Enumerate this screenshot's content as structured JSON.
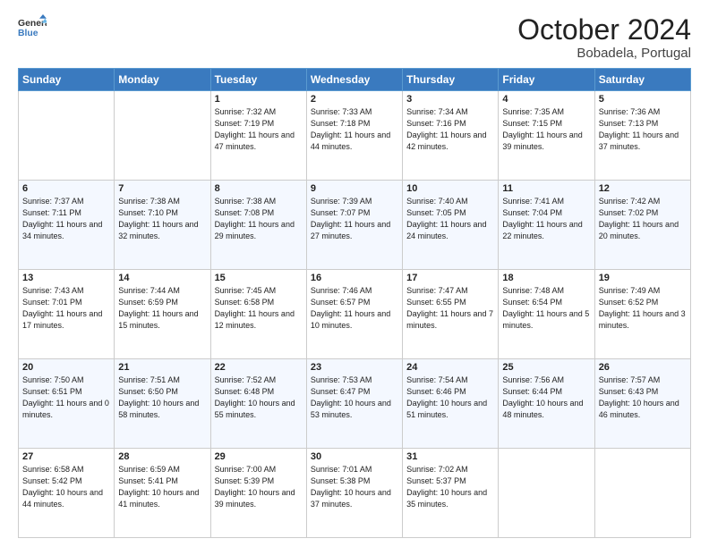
{
  "header": {
    "logo_line1": "General",
    "logo_line2": "Blue",
    "title": "October 2024",
    "subtitle": "Bobadela, Portugal"
  },
  "weekdays": [
    "Sunday",
    "Monday",
    "Tuesday",
    "Wednesday",
    "Thursday",
    "Friday",
    "Saturday"
  ],
  "weeks": [
    [
      {
        "day": "",
        "info": ""
      },
      {
        "day": "",
        "info": ""
      },
      {
        "day": "1",
        "info": "Sunrise: 7:32 AM\nSunset: 7:19 PM\nDaylight: 11 hours and 47 minutes."
      },
      {
        "day": "2",
        "info": "Sunrise: 7:33 AM\nSunset: 7:18 PM\nDaylight: 11 hours and 44 minutes."
      },
      {
        "day": "3",
        "info": "Sunrise: 7:34 AM\nSunset: 7:16 PM\nDaylight: 11 hours and 42 minutes."
      },
      {
        "day": "4",
        "info": "Sunrise: 7:35 AM\nSunset: 7:15 PM\nDaylight: 11 hours and 39 minutes."
      },
      {
        "day": "5",
        "info": "Sunrise: 7:36 AM\nSunset: 7:13 PM\nDaylight: 11 hours and 37 minutes."
      }
    ],
    [
      {
        "day": "6",
        "info": "Sunrise: 7:37 AM\nSunset: 7:11 PM\nDaylight: 11 hours and 34 minutes."
      },
      {
        "day": "7",
        "info": "Sunrise: 7:38 AM\nSunset: 7:10 PM\nDaylight: 11 hours and 32 minutes."
      },
      {
        "day": "8",
        "info": "Sunrise: 7:38 AM\nSunset: 7:08 PM\nDaylight: 11 hours and 29 minutes."
      },
      {
        "day": "9",
        "info": "Sunrise: 7:39 AM\nSunset: 7:07 PM\nDaylight: 11 hours and 27 minutes."
      },
      {
        "day": "10",
        "info": "Sunrise: 7:40 AM\nSunset: 7:05 PM\nDaylight: 11 hours and 24 minutes."
      },
      {
        "day": "11",
        "info": "Sunrise: 7:41 AM\nSunset: 7:04 PM\nDaylight: 11 hours and 22 minutes."
      },
      {
        "day": "12",
        "info": "Sunrise: 7:42 AM\nSunset: 7:02 PM\nDaylight: 11 hours and 20 minutes."
      }
    ],
    [
      {
        "day": "13",
        "info": "Sunrise: 7:43 AM\nSunset: 7:01 PM\nDaylight: 11 hours and 17 minutes."
      },
      {
        "day": "14",
        "info": "Sunrise: 7:44 AM\nSunset: 6:59 PM\nDaylight: 11 hours and 15 minutes."
      },
      {
        "day": "15",
        "info": "Sunrise: 7:45 AM\nSunset: 6:58 PM\nDaylight: 11 hours and 12 minutes."
      },
      {
        "day": "16",
        "info": "Sunrise: 7:46 AM\nSunset: 6:57 PM\nDaylight: 11 hours and 10 minutes."
      },
      {
        "day": "17",
        "info": "Sunrise: 7:47 AM\nSunset: 6:55 PM\nDaylight: 11 hours and 7 minutes."
      },
      {
        "day": "18",
        "info": "Sunrise: 7:48 AM\nSunset: 6:54 PM\nDaylight: 11 hours and 5 minutes."
      },
      {
        "day": "19",
        "info": "Sunrise: 7:49 AM\nSunset: 6:52 PM\nDaylight: 11 hours and 3 minutes."
      }
    ],
    [
      {
        "day": "20",
        "info": "Sunrise: 7:50 AM\nSunset: 6:51 PM\nDaylight: 11 hours and 0 minutes."
      },
      {
        "day": "21",
        "info": "Sunrise: 7:51 AM\nSunset: 6:50 PM\nDaylight: 10 hours and 58 minutes."
      },
      {
        "day": "22",
        "info": "Sunrise: 7:52 AM\nSunset: 6:48 PM\nDaylight: 10 hours and 55 minutes."
      },
      {
        "day": "23",
        "info": "Sunrise: 7:53 AM\nSunset: 6:47 PM\nDaylight: 10 hours and 53 minutes."
      },
      {
        "day": "24",
        "info": "Sunrise: 7:54 AM\nSunset: 6:46 PM\nDaylight: 10 hours and 51 minutes."
      },
      {
        "day": "25",
        "info": "Sunrise: 7:56 AM\nSunset: 6:44 PM\nDaylight: 10 hours and 48 minutes."
      },
      {
        "day": "26",
        "info": "Sunrise: 7:57 AM\nSunset: 6:43 PM\nDaylight: 10 hours and 46 minutes."
      }
    ],
    [
      {
        "day": "27",
        "info": "Sunrise: 6:58 AM\nSunset: 5:42 PM\nDaylight: 10 hours and 44 minutes."
      },
      {
        "day": "28",
        "info": "Sunrise: 6:59 AM\nSunset: 5:41 PM\nDaylight: 10 hours and 41 minutes."
      },
      {
        "day": "29",
        "info": "Sunrise: 7:00 AM\nSunset: 5:39 PM\nDaylight: 10 hours and 39 minutes."
      },
      {
        "day": "30",
        "info": "Sunrise: 7:01 AM\nSunset: 5:38 PM\nDaylight: 10 hours and 37 minutes."
      },
      {
        "day": "31",
        "info": "Sunrise: 7:02 AM\nSunset: 5:37 PM\nDaylight: 10 hours and 35 minutes."
      },
      {
        "day": "",
        "info": ""
      },
      {
        "day": "",
        "info": ""
      }
    ]
  ]
}
